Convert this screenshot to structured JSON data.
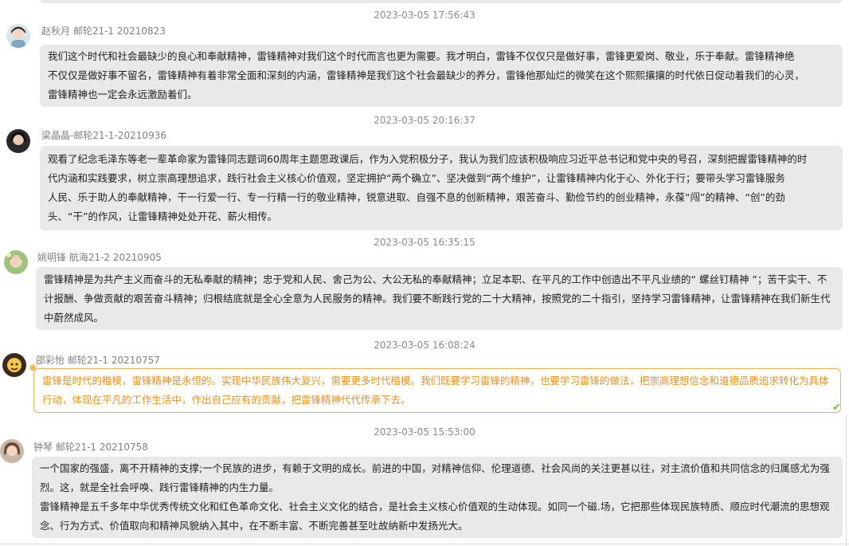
{
  "messages": [
    {
      "timestamp": "2023-03-05 17:56:43",
      "author": "赵秋月 邮轮21-1 20210823",
      "lines": [
        "我们这个时代和社会最缺少的良心和奉献精神，雷锋精神对我们这个时代而言也更为需要。我才明白，雷锋不仅仅只是做好事，雷锋更爱岗、敬业，乐于奉献。雷锋精神绝",
        "不仅仅是做好事不留名，雷锋精神有着非常全面和深刻的内涵，雷锋精神是我们这个社会最缺少的养分，雷锋他那灿烂的微笑在这个熙熙攘攘的时代依日促动着我们的心灵，",
        "雷锋精神也一定会永远激励着们。"
      ]
    },
    {
      "timestamp": "2023-03-05 20:16:37",
      "author": "梁晶晶-邮轮21-1-20210936",
      "lines": [
        "观看了纪念毛泽东等老一辈革命家为雷锋同志题词60周年主题思政课后，作为入党积极分子，我认为我们应该积极响应习近平总书记和党中央的号召，深刻把握雷锋精神的时",
        "代内涵和实践要求，树立崇高理想追求，践行社会主义核心价值观，坚定拥护“两个确立”、坚决做到“两个维护”，让雷锋精神内化于心、外化于行；要带头学习雷锋服务",
        "人民、乐于助人的奉献精神，干一行爱一行、专一行精一行的敬业精神，锐意进取、自强不息的创新精神，艰苦奋斗、勤俭节约的创业精神，永葆“闯”的精神、“创”的劲",
        "头、“干”的作风，让雷锋精神处处开花、薪火相传。"
      ]
    },
    {
      "timestamp": "2023-03-05 16:35:15",
      "author": "姚明锋 航海21-2 20210905",
      "lines": [
        "雷锋精神是为共产主义而奋斗的无私奉献的精神；忠于党和人民、舍己为公、大公无私的奉献精神；立足本职、在平凡的工作中创造出不平凡业绩的“ 螺丝钉精神 ”；苦干实干、不",
        "计报酬、争做贡献的艰苦奋斗精神；归根结底就是全心全意为人民服务的精神。我们要不断践行党的二十大精神，按照党的二十指引，坚持学习雷锋精神，让雷锋精神在我们新生代",
        "中蔚然成风。"
      ]
    },
    {
      "timestamp": "2023-03-05 16:08:24",
      "author": "邵彩怡 邮轮21-1 20210757",
      "lines": [
        "雷锋是时代的楷模，雷锋精神是永恒的。实现中华民族伟大复兴，需要更多时代楷模。我们既要学习雷锋的精神，也要学习雷锋的做法，把崇高理想信念和道德品质追求转化为具体",
        "行动，体现在平凡的工作生活中，作出自己应有的贡献，把雷锋精神代代传承下去。"
      ]
    },
    {
      "timestamp": "2023-03-05 15:53:00",
      "author": "钟琴 邮轮21-1 20210758",
      "lines": [
        "一个国家的强盛，离不开精神的支撑;一个民族的进步，有赖于文明的成长。前进的中国，对精神信仰、伦理道德、社会风尚的关注更甚以往，对主流价值和共同信念的归属感尤为强",
        "烈。这，就是全社会呼唤、践行雷锋精神的内生力量。",
        "雷锋精神是五千多年中华优秀传统文化和红色革命文化、社会主义文化的结合，是社会主义核心价值观的生动体现。如同一个磁.场，它把那些体现民族特质、顺应时代潮流的思想观",
        "念、行为方式、价值取向和精神风貌纳入其中，在不断丰富、不断完善甚至吐故纳新中发扬光大。"
      ]
    }
  ],
  "colors": {
    "bubble": "#e9e9e9",
    "highlight_border": "#f2b05a",
    "highlight_text": "#e8911f",
    "meta_text": "#8a8a8a"
  },
  "icons": {
    "highlight_corner": "sparkle-icon",
    "highlight_end": "check-icon"
  }
}
